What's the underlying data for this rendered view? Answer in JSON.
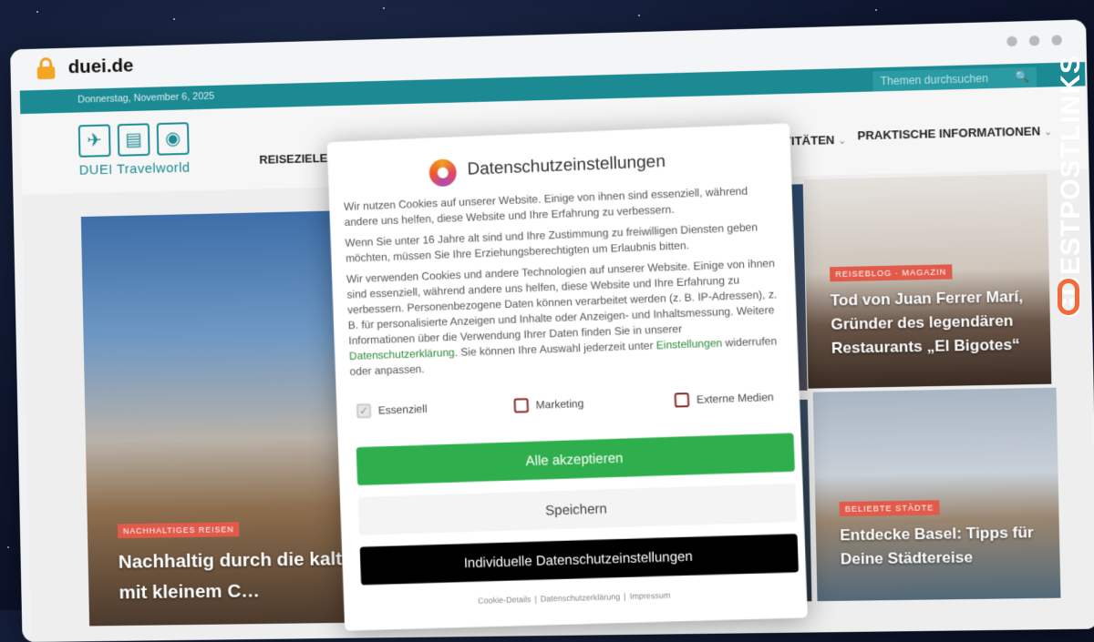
{
  "browser": {
    "url": "duei.de",
    "lock_icon": "lock-icon"
  },
  "site": {
    "date": "Donnerstag, November 6, 2025",
    "search_placeholder": "Themen durchsuchen",
    "logo_text": "DUEI  Travelworld",
    "nav": {
      "left": "REISEZIELE",
      "right1": "IVITÄTEN",
      "right2": "PRAKTISCHE INFORMATIONEN"
    },
    "tiles": {
      "main": {
        "tag": "NACHHALTIGES REISEN",
        "title": "Nachhaltig durch die kalte J… Ausflugstipps mit kleinem C…"
      },
      "r1": {
        "tag": "REISEBLOG · MAGAZIN",
        "title": "Tod von Juan Ferrer Marí, Gründer des legendären Restaurants „El Bigotes“"
      },
      "r2": {
        "tag": "BELIEBTE STÄDTE",
        "title": "Entdecke Basel: Tipps für Deine Städtereise"
      }
    }
  },
  "modal": {
    "title": "Datenschutzeinstellungen",
    "p1": "Wir nutzen Cookies auf unserer Website. Einige von ihnen sind essenziell, während andere uns helfen, diese Website und Ihre Erfahrung zu verbessern.",
    "p2": "Wenn Sie unter 16 Jahre alt sind und Ihre Zustimmung zu freiwilligen Diensten geben möchten, müssen Sie Ihre Erziehungsberechtigten um Erlaubnis bitten.",
    "p3_a": "Wir verwenden Cookies und andere Technologien auf unserer Website. Einige von ihnen sind essenziell, während andere uns helfen, diese Website und Ihre Erfahrung zu verbessern. Personenbezogene Daten können verarbeitet werden (z. B. IP-Adressen), z. B. für personalisierte Anzeigen und Inhalte oder Anzeigen- und Inhaltsmessung. Weitere Informationen über die Verwendung Ihrer Daten finden Sie in unserer ",
    "p3_link1": "Datenschutzerklärung",
    "p3_b": ". Sie können Ihre Auswahl jederzeit unter ",
    "p3_link2": "Einstellungen",
    "p3_c": " widerrufen oder anpassen.",
    "checks": {
      "essential": "Essenziell",
      "marketing": "Marketing",
      "external": "Externe Medien"
    },
    "buttons": {
      "accept_all": "Alle akzeptieren",
      "save": "Speichern",
      "individual": "Individuelle Datenschutzeinstellungen"
    },
    "footer": {
      "cookie": "Cookie-Details",
      "privacy": "Datenschutzerklärung",
      "imprint": "Impressum"
    }
  },
  "watermark": {
    "text": "GUESTPOSTLINKS"
  }
}
